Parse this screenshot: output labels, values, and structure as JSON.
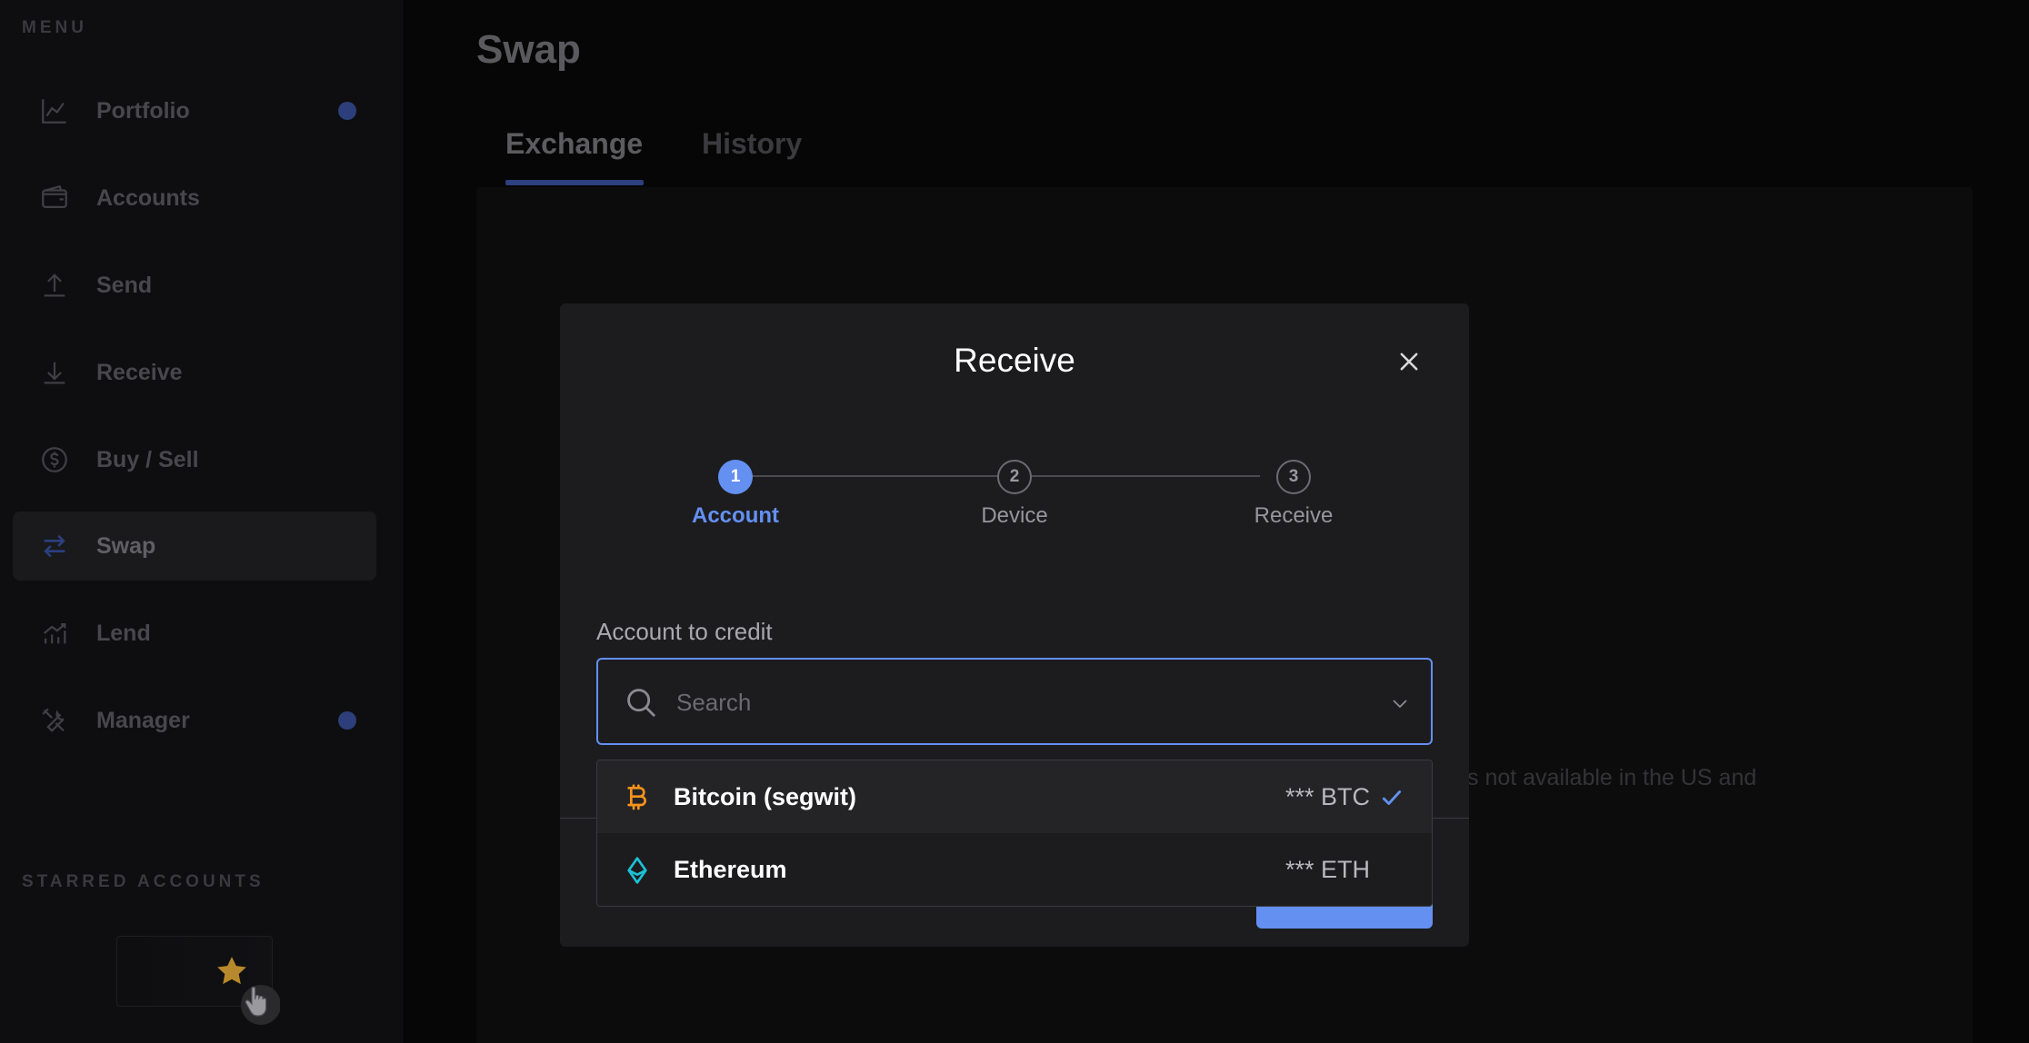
{
  "sidebar": {
    "menu_title": "MENU",
    "items": [
      {
        "label": "Portfolio",
        "icon": "chart-line-icon",
        "has_dot": true
      },
      {
        "label": "Accounts",
        "icon": "wallet-icon",
        "has_dot": false
      },
      {
        "label": "Send",
        "icon": "upload-arrow-icon",
        "has_dot": false
      },
      {
        "label": "Receive",
        "icon": "download-arrow-icon",
        "has_dot": false
      },
      {
        "label": "Buy / Sell",
        "icon": "dollar-circle-icon",
        "has_dot": false
      },
      {
        "label": "Swap",
        "icon": "swap-arrows-icon",
        "has_dot": false,
        "active": true
      },
      {
        "label": "Lend",
        "icon": "bar-growth-icon",
        "has_dot": false
      },
      {
        "label": "Manager",
        "icon": "tools-icon",
        "has_dot": true
      }
    ],
    "starred_title": "STARRED ACCOUNTS"
  },
  "main": {
    "page_title": "Swap",
    "tabs": [
      {
        "label": "Exchange",
        "active": true
      },
      {
        "label": "History",
        "active": false
      }
    ],
    "background_notice": "s not available in the US and"
  },
  "modal": {
    "title": "Receive",
    "steps": [
      {
        "number": "1",
        "label": "Account",
        "active": true
      },
      {
        "number": "2",
        "label": "Device",
        "active": false
      },
      {
        "number": "3",
        "label": "Receive",
        "active": false
      }
    ],
    "field_label": "Account to credit",
    "search_placeholder": "Search",
    "accounts": [
      {
        "name": "Bitcoin (segwit)",
        "balance": "*** BTC",
        "icon": "bitcoin-icon",
        "color": "#f7931a",
        "selected": true
      },
      {
        "name": "Ethereum",
        "balance": "*** ETH",
        "icon": "ethereum-icon",
        "color": "#1cc1d6",
        "selected": false
      }
    ]
  },
  "colors": {
    "accent": "#6490f1",
    "nav_dot": "#2d3f7a",
    "star": "#b8892c"
  }
}
